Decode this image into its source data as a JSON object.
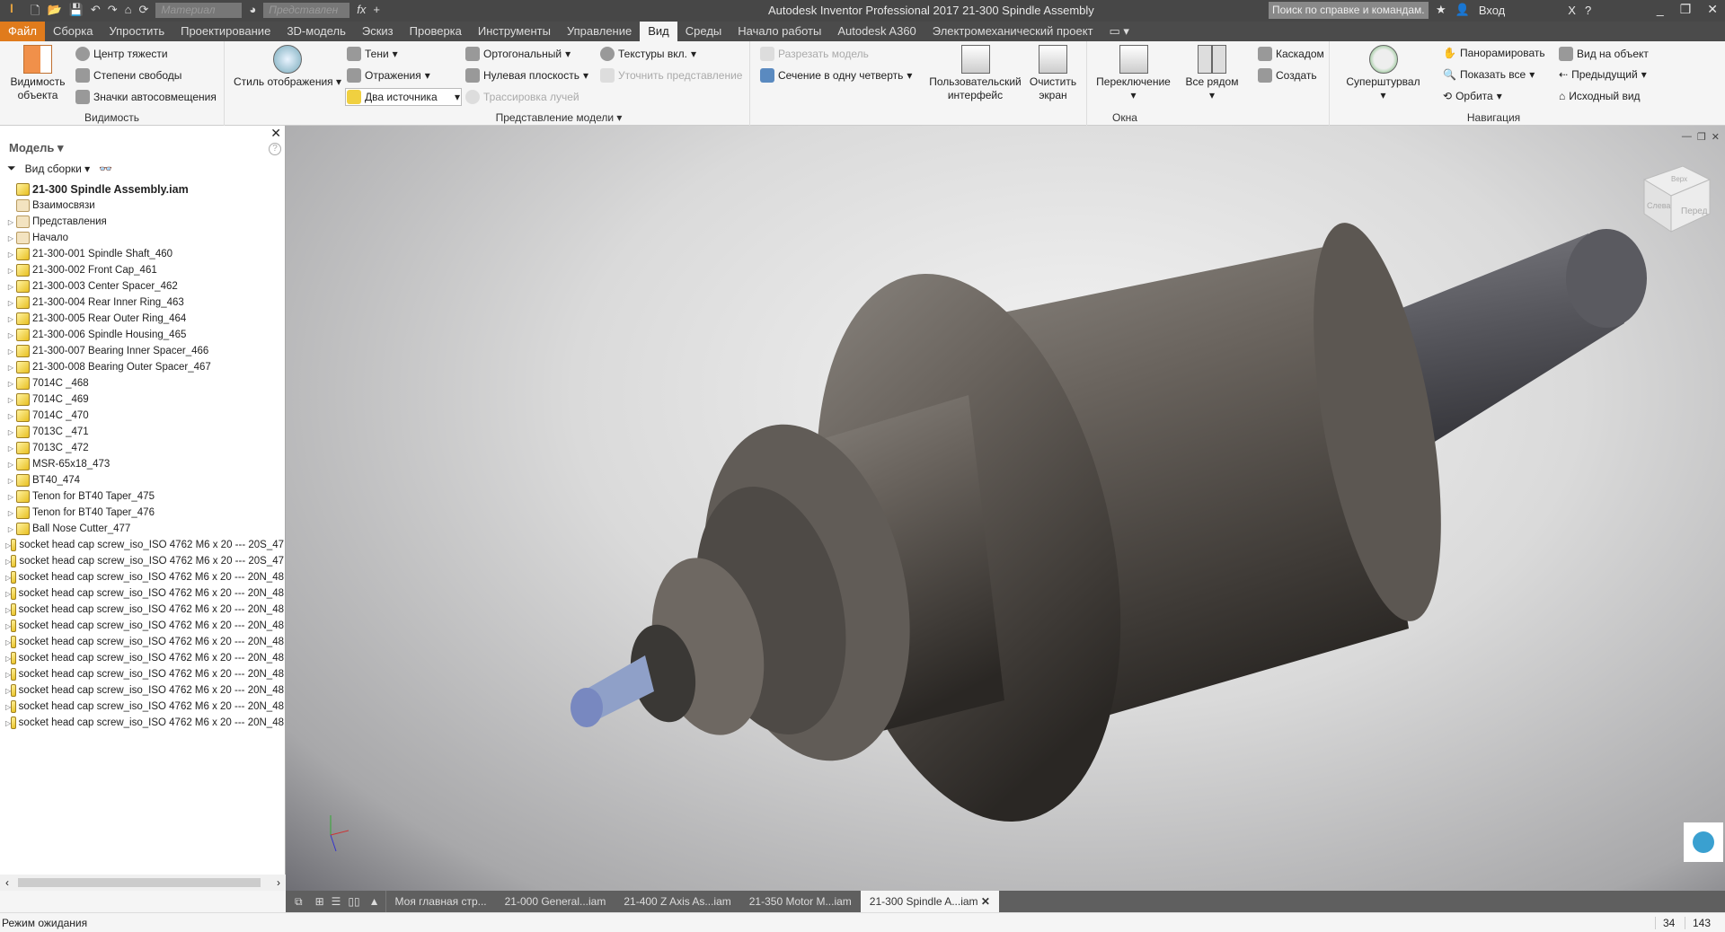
{
  "titlebar": {
    "app_title": "Autodesk Inventor Professional 2017    21-300 Spindle Assembly",
    "material_placeholder": "Материал",
    "appearance_placeholder": "Представлен",
    "search_placeholder": "Поиск по справке и командам.",
    "sign_in": "Вход",
    "logo_text": "PRO"
  },
  "menu_tabs": [
    "Файл",
    "Сборка",
    "Упростить",
    "Проектирование",
    "3D-модель",
    "Эскиз",
    "Проверка",
    "Инструменты",
    "Управление",
    "Вид",
    "Среды",
    "Начало работы",
    "Autodesk A360",
    "Электромеханический проект"
  ],
  "ribbon": {
    "visibility": {
      "label": "Видимость",
      "object_visibility": "Видимость объекта",
      "center_gravity": "Центр тяжести",
      "dof": "Степени свободы",
      "autolimits": "Значки автосовмещения"
    },
    "appearance": {
      "label": "Представление модели",
      "visual_style": "Стиль отображения",
      "shadows": "Тени",
      "reflections": "Отражения",
      "lighting": "Два источника",
      "ortho": "Ортогональный",
      "ground": "Нулевая плоскость",
      "raytrace": "Трассировка лучей",
      "textures": "Текстуры вкл.",
      "refine": "Уточнить представление",
      "half_section": "Разрезать модель",
      "quarter_section": "Сечение в одну четверть"
    },
    "windows": {
      "label": "Окна",
      "user_interface": "Пользовательский интерфейс",
      "clean_screen": "Очистить экран",
      "switch": "Переключение",
      "tile": "Все рядом",
      "cascade": "Каскадом",
      "new": "Создать"
    },
    "navigate": {
      "label": "Навигация",
      "steering": "Суперштурвал",
      "pan": "Панорамировать",
      "zoom_all": "Показать все",
      "orbit": "Орбита",
      "look_at": "Вид на объект",
      "previous": "Предыдущий",
      "home": "Исходный вид"
    }
  },
  "browser": {
    "title": "Модель",
    "view": "Вид сборки",
    "items": [
      {
        "label": "21-300 Spindle Assembly.iam",
        "root": true
      },
      {
        "label": "Взаимосвязи",
        "folder": true,
        "noexp": true
      },
      {
        "label": "Представления",
        "folder": true
      },
      {
        "label": "Начало",
        "folder": true
      },
      {
        "label": "21-300-001 Spindle Shaft_460"
      },
      {
        "label": "21-300-002 Front Cap_461"
      },
      {
        "label": "21-300-003 Center Spacer_462"
      },
      {
        "label": "21-300-004 Rear Inner Ring_463"
      },
      {
        "label": "21-300-005 Rear Outer Ring_464"
      },
      {
        "label": "21-300-006 Spindle Housing_465"
      },
      {
        "label": "21-300-007 Bearing Inner Spacer_466"
      },
      {
        "label": "21-300-008 Bearing Outer Spacer_467"
      },
      {
        "label": "7014C _468"
      },
      {
        "label": "7014C _469"
      },
      {
        "label": "7014C _470"
      },
      {
        "label": "7013C _471"
      },
      {
        "label": "7013C _472"
      },
      {
        "label": "MSR-65x18_473"
      },
      {
        "label": "BT40_474"
      },
      {
        "label": "Tenon for BT40 Taper_475"
      },
      {
        "label": "Tenon for BT40 Taper_476"
      },
      {
        "label": "Ball Nose Cutter_477"
      },
      {
        "label": "socket head cap screw_iso_ISO 4762 M6 x 20 --- 20S_47"
      },
      {
        "label": "socket head cap screw_iso_ISO 4762 M6 x 20 --- 20S_47"
      },
      {
        "label": "socket head cap screw_iso_ISO 4762 M6 x 20 --- 20N_48"
      },
      {
        "label": "socket head cap screw_iso_ISO 4762 M6 x 20 --- 20N_48"
      },
      {
        "label": "socket head cap screw_iso_ISO 4762 M6 x 20 --- 20N_48"
      },
      {
        "label": "socket head cap screw_iso_ISO 4762 M6 x 20 --- 20N_48"
      },
      {
        "label": "socket head cap screw_iso_ISO 4762 M6 x 20 --- 20N_48"
      },
      {
        "label": "socket head cap screw_iso_ISO 4762 M6 x 20 --- 20N_48"
      },
      {
        "label": "socket head cap screw_iso_ISO 4762 M6 x 20 --- 20N_48"
      },
      {
        "label": "socket head cap screw_iso_ISO 4762 M6 x 20 --- 20N_48"
      },
      {
        "label": "socket head cap screw_iso_ISO 4762 M6 x 20 --- 20N_48"
      },
      {
        "label": "socket head cap screw_iso_ISO 4762 M6 x 20 --- 20N_48"
      }
    ]
  },
  "viewcube": {
    "top": "Верх",
    "front": "Перед",
    "left": "Слева"
  },
  "doc_tabs": [
    "Моя главная стр...",
    "21-000 General...iam",
    "21-400 Z Axis As...iam",
    "21-350 Motor M...iam",
    "21-300 Spindle A...iam"
  ],
  "status": {
    "text": "Режим ожидания",
    "n1": "34",
    "n2": "143"
  },
  "colors": {
    "file_tab": "#e07b1c",
    "titlebar": "#474747"
  }
}
